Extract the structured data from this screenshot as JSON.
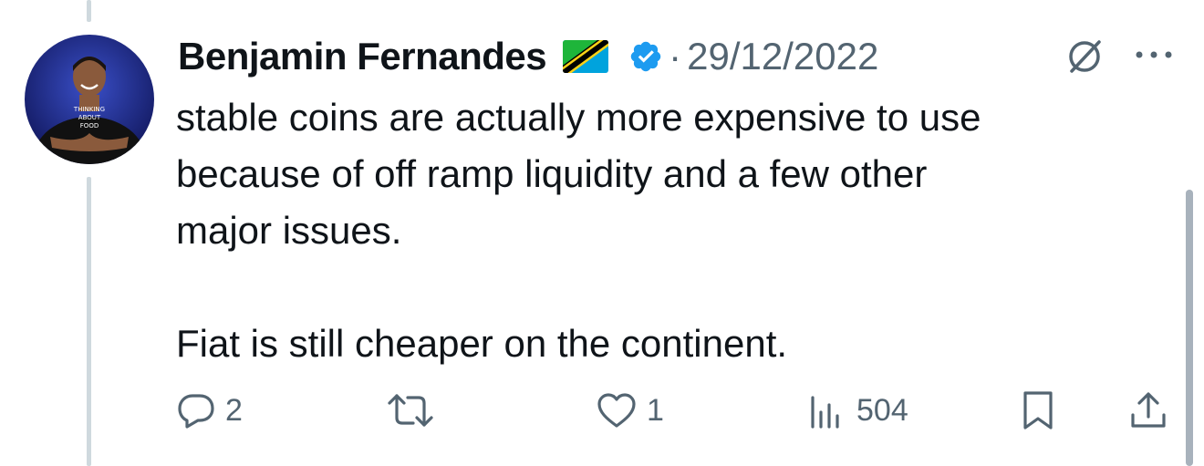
{
  "tweet": {
    "author_name": "Benjamin Fernandes",
    "separator": "·",
    "date": "29/12/2022",
    "text_lines": [
      "stable coins are actually more expensive to use",
      "because of off ramp liquidity and a few other",
      "major issues."
    ],
    "text_line_2": "Fiat is still cheaper on the continent.",
    "avatar_shirt_text": [
      "THINKING",
      "ABOUT",
      "FOOD"
    ]
  },
  "actions": {
    "replies": "2",
    "likes": "1",
    "views": "504"
  },
  "colors": {
    "secondary_text": "#536471",
    "verified_blue": "#1d9bf0",
    "thread_line": "#cfd9de"
  },
  "icons": [
    "grok-icon",
    "more-icon",
    "reply-icon",
    "retweet-icon",
    "like-icon",
    "views-icon",
    "bookmark-icon",
    "share-icon",
    "verified-badge-icon",
    "tanzania-flag-icon"
  ]
}
